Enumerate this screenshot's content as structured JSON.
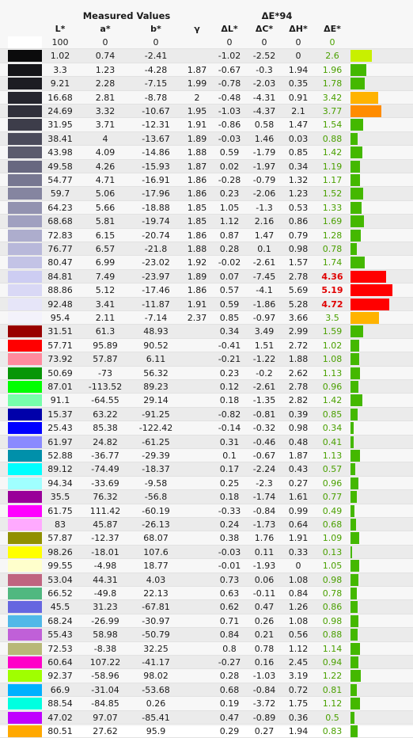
{
  "headers": {
    "measured": "Measured Values",
    "delta_e94": "ΔE*94"
  },
  "columns": [
    "L*",
    "a*",
    "b*",
    "γ",
    "ΔL*",
    "ΔC*",
    "ΔH*",
    "ΔE*"
  ],
  "colors": {
    "good": "#44b800",
    "warn": "#ffb300",
    "bad": "#ff0000",
    "lime": "#c8f000",
    "orange": "#ff8c00"
  },
  "rows": [
    {
      "sw": "#ffffff",
      "L": "100",
      "a": "0",
      "b": "0",
      "g": "",
      "dL": "0",
      "dC": "0",
      "dH": "0",
      "dE": "0",
      "lvl": "good",
      "v": 0
    },
    {
      "sw": "#0b0b0c",
      "L": "1.02",
      "a": "0.74",
      "b": "-2.41",
      "g": "",
      "dL": "-1.02",
      "dC": "-2.52",
      "dH": "0",
      "dE": "2.6",
      "lvl": "lime",
      "v": 2.6
    },
    {
      "sw": "#141418",
      "L": "3.3",
      "a": "1.23",
      "b": "-4.28",
      "g": "1.87",
      "dL": "-0.67",
      "dC": "-0.3",
      "dH": "1.94",
      "dE": "1.96",
      "lvl": "good",
      "v": 1.96
    },
    {
      "sw": "#1c1c22",
      "L": "9.21",
      "a": "2.28",
      "b": "-7.15",
      "g": "1.99",
      "dL": "-0.78",
      "dC": "-2.03",
      "dH": "0.35",
      "dE": "1.78",
      "lvl": "good",
      "v": 1.78
    },
    {
      "sw": "#25252e",
      "L": "16.68",
      "a": "2.81",
      "b": "-8.78",
      "g": "2",
      "dL": "-0.48",
      "dC": "-4.31",
      "dH": "0.91",
      "dE": "3.42",
      "lvl": "warn",
      "v": 3.42
    },
    {
      "sw": "#30303b",
      "L": "24.69",
      "a": "3.32",
      "b": "-10.67",
      "g": "1.95",
      "dL": "-1.03",
      "dC": "-4.37",
      "dH": "2.1",
      "dE": "3.77",
      "lvl": "orange",
      "v": 3.77
    },
    {
      "sw": "#3d3d4a",
      "L": "31.95",
      "a": "3.71",
      "b": "-12.31",
      "g": "1.91",
      "dL": "-0.86",
      "dC": "0.58",
      "dH": "1.47",
      "dE": "1.54",
      "lvl": "good",
      "v": 1.54
    },
    {
      "sw": "#4b4b5b",
      "L": "38.41",
      "a": "4",
      "b": "-13.67",
      "g": "1.89",
      "dL": "-0.03",
      "dC": "1.46",
      "dH": "0.03",
      "dE": "0.88",
      "lvl": "good",
      "v": 0.88
    },
    {
      "sw": "#5b5b6d",
      "L": "43.98",
      "a": "4.09",
      "b": "-14.86",
      "g": "1.88",
      "dL": "0.59",
      "dC": "-1.79",
      "dH": "0.85",
      "dE": "1.42",
      "lvl": "good",
      "v": 1.42
    },
    {
      "sw": "#686880",
      "L": "49.58",
      "a": "4.26",
      "b": "-15.93",
      "g": "1.87",
      "dL": "0.02",
      "dC": "-1.97",
      "dH": "0.34",
      "dE": "1.19",
      "lvl": "good",
      "v": 1.19
    },
    {
      "sw": "#777791",
      "L": "54.77",
      "a": "4.71",
      "b": "-16.91",
      "g": "1.86",
      "dL": "-0.28",
      "dC": "-0.79",
      "dH": "1.32",
      "dE": "1.17",
      "lvl": "good",
      "v": 1.17
    },
    {
      "sw": "#8585a0",
      "L": "59.7",
      "a": "5.06",
      "b": "-17.96",
      "g": "1.86",
      "dL": "0.23",
      "dC": "-2.06",
      "dH": "1.23",
      "dE": "1.52",
      "lvl": "good",
      "v": 1.52
    },
    {
      "sw": "#9292b0",
      "L": "64.23",
      "a": "5.66",
      "b": "-18.88",
      "g": "1.85",
      "dL": "1.05",
      "dC": "-1.3",
      "dH": "0.53",
      "dE": "1.33",
      "lvl": "good",
      "v": 1.33
    },
    {
      "sw": "#a0a0c0",
      "L": "68.68",
      "a": "5.81",
      "b": "-19.74",
      "g": "1.85",
      "dL": "1.12",
      "dC": "2.16",
      "dH": "0.86",
      "dE": "1.69",
      "lvl": "good",
      "v": 1.69
    },
    {
      "sw": "#adadcd",
      "L": "72.83",
      "a": "6.15",
      "b": "-20.74",
      "g": "1.86",
      "dL": "0.87",
      "dC": "1.47",
      "dH": "0.79",
      "dE": "1.28",
      "lvl": "good",
      "v": 1.28
    },
    {
      "sw": "#b8b8da",
      "L": "76.77",
      "a": "6.57",
      "b": "-21.8",
      "g": "1.88",
      "dL": "0.28",
      "dC": "0.1",
      "dH": "0.98",
      "dE": "0.78",
      "lvl": "good",
      "v": 0.78
    },
    {
      "sw": "#c3c3e6",
      "L": "80.47",
      "a": "6.99",
      "b": "-23.02",
      "g": "1.92",
      "dL": "-0.02",
      "dC": "-2.61",
      "dH": "1.57",
      "dE": "1.74",
      "lvl": "good",
      "v": 1.74
    },
    {
      "sw": "#cdcdf2",
      "L": "84.81",
      "a": "7.49",
      "b": "-23.97",
      "g": "1.89",
      "dL": "0.07",
      "dC": "-7.45",
      "dH": "2.78",
      "dE": "4.36",
      "lvl": "bad",
      "v": 4.36
    },
    {
      "sw": "#d9d8f5",
      "L": "88.86",
      "a": "5.12",
      "b": "-17.46",
      "g": "1.86",
      "dL": "0.57",
      "dC": "-4.1",
      "dH": "5.69",
      "dE": "5.19",
      "lvl": "bad",
      "v": 5.19
    },
    {
      "sw": "#e6e5f8",
      "L": "92.48",
      "a": "3.41",
      "b": "-11.87",
      "g": "1.91",
      "dL": "0.59",
      "dC": "-1.86",
      "dH": "5.28",
      "dE": "4.72",
      "lvl": "bad",
      "v": 4.72
    },
    {
      "sw": "#f3f2fb",
      "L": "95.4",
      "a": "2.11",
      "b": "-7.14",
      "g": "2.37",
      "dL": "0.85",
      "dC": "-0.97",
      "dH": "3.66",
      "dE": "3.5",
      "lvl": "warn",
      "v": 3.5
    },
    {
      "sw": "#990000",
      "L": "31.51",
      "a": "61.3",
      "b": "48.93",
      "g": "",
      "dL": "0.34",
      "dC": "3.49",
      "dH": "2.99",
      "dE": "1.59",
      "lvl": "good",
      "v": 1.59
    },
    {
      "sw": "#ff0000",
      "L": "57.71",
      "a": "95.89",
      "b": "90.52",
      "g": "",
      "dL": "-0.41",
      "dC": "1.51",
      "dH": "2.72",
      "dE": "1.02",
      "lvl": "good",
      "v": 1.02
    },
    {
      "sw": "#ff8b9e",
      "L": "73.92",
      "a": "57.87",
      "b": "6.11",
      "g": "",
      "dL": "-0.21",
      "dC": "-1.22",
      "dH": "1.88",
      "dE": "1.08",
      "lvl": "good",
      "v": 1.08
    },
    {
      "sw": "#079607",
      "L": "50.69",
      "a": "-73",
      "b": "56.32",
      "g": "",
      "dL": "0.23",
      "dC": "-0.2",
      "dH": "2.62",
      "dE": "1.13",
      "lvl": "good",
      "v": 1.13
    },
    {
      "sw": "#00ff00",
      "L": "87.01",
      "a": "-113.52",
      "b": "89.23",
      "g": "",
      "dL": "0.12",
      "dC": "-2.61",
      "dH": "2.78",
      "dE": "0.96",
      "lvl": "good",
      "v": 0.96
    },
    {
      "sw": "#77ffaa",
      "L": "91.1",
      "a": "-64.55",
      "b": "29.14",
      "g": "",
      "dL": "0.18",
      "dC": "-1.35",
      "dH": "2.82",
      "dE": "1.42",
      "lvl": "good",
      "v": 1.42
    },
    {
      "sw": "#0000aa",
      "L": "15.37",
      "a": "63.22",
      "b": "-91.25",
      "g": "",
      "dL": "-0.82",
      "dC": "-0.81",
      "dH": "0.39",
      "dE": "0.85",
      "lvl": "good",
      "v": 0.85
    },
    {
      "sw": "#0000ff",
      "L": "25.43",
      "a": "85.38",
      "b": "-122.42",
      "g": "",
      "dL": "-0.14",
      "dC": "-0.32",
      "dH": "0.98",
      "dE": "0.34",
      "lvl": "good",
      "v": 0.34
    },
    {
      "sw": "#8a8aff",
      "L": "61.97",
      "a": "24.82",
      "b": "-61.25",
      "g": "",
      "dL": "0.31",
      "dC": "-0.46",
      "dH": "0.48",
      "dE": "0.41",
      "lvl": "good",
      "v": 0.41
    },
    {
      "sw": "#0090aa",
      "L": "52.88",
      "a": "-36.77",
      "b": "-29.39",
      "g": "",
      "dL": "0.1",
      "dC": "-0.67",
      "dH": "1.87",
      "dE": "1.13",
      "lvl": "good",
      "v": 1.13
    },
    {
      "sw": "#00ffff",
      "L": "89.12",
      "a": "-74.49",
      "b": "-18.37",
      "g": "",
      "dL": "0.17",
      "dC": "-2.24",
      "dH": "0.43",
      "dE": "0.57",
      "lvl": "good",
      "v": 0.57
    },
    {
      "sw": "#a0ffff",
      "L": "94.34",
      "a": "-33.69",
      "b": "-9.58",
      "g": "",
      "dL": "0.25",
      "dC": "-2.3",
      "dH": "0.27",
      "dE": "0.96",
      "lvl": "good",
      "v": 0.96
    },
    {
      "sw": "#990099",
      "L": "35.5",
      "a": "76.32",
      "b": "-56.8",
      "g": "",
      "dL": "0.18",
      "dC": "-1.74",
      "dH": "1.61",
      "dE": "0.77",
      "lvl": "good",
      "v": 0.77
    },
    {
      "sw": "#ff00ff",
      "L": "61.75",
      "a": "111.42",
      "b": "-60.19",
      "g": "",
      "dL": "-0.33",
      "dC": "-0.84",
      "dH": "0.99",
      "dE": "0.49",
      "lvl": "good",
      "v": 0.49
    },
    {
      "sw": "#ffaaff",
      "L": "83",
      "a": "45.87",
      "b": "-26.13",
      "g": "",
      "dL": "0.24",
      "dC": "-1.73",
      "dH": "0.64",
      "dE": "0.68",
      "lvl": "good",
      "v": 0.68
    },
    {
      "sw": "#909000",
      "L": "57.87",
      "a": "-12.37",
      "b": "68.07",
      "g": "",
      "dL": "0.38",
      "dC": "1.76",
      "dH": "1.91",
      "dE": "1.09",
      "lvl": "good",
      "v": 1.09
    },
    {
      "sw": "#ffff00",
      "L": "98.26",
      "a": "-18.01",
      "b": "107.6",
      "g": "",
      "dL": "-0.03",
      "dC": "0.11",
      "dH": "0.33",
      "dE": "0.13",
      "lvl": "good",
      "v": 0.13
    },
    {
      "sw": "#ffffcc",
      "L": "99.55",
      "a": "-4.98",
      "b": "18.77",
      "g": "",
      "dL": "-0.01",
      "dC": "-1.93",
      "dH": "0",
      "dE": "1.05",
      "lvl": "good",
      "v": 1.05
    },
    {
      "sw": "#c06480",
      "L": "53.04",
      "a": "44.31",
      "b": "4.03",
      "g": "",
      "dL": "0.73",
      "dC": "0.06",
      "dH": "1.08",
      "dE": "0.98",
      "lvl": "good",
      "v": 0.98
    },
    {
      "sw": "#50b880",
      "L": "66.52",
      "a": "-49.8",
      "b": "22.13",
      "g": "",
      "dL": "0.63",
      "dC": "-0.11",
      "dH": "0.84",
      "dE": "0.78",
      "lvl": "good",
      "v": 0.78
    },
    {
      "sw": "#6666e0",
      "L": "45.5",
      "a": "31.23",
      "b": "-67.81",
      "g": "",
      "dL": "0.62",
      "dC": "0.47",
      "dH": "1.26",
      "dE": "0.86",
      "lvl": "good",
      "v": 0.86
    },
    {
      "sw": "#50b8e8",
      "L": "68.24",
      "a": "-26.99",
      "b": "-30.97",
      "g": "",
      "dL": "0.71",
      "dC": "0.26",
      "dH": "1.08",
      "dE": "0.98",
      "lvl": "good",
      "v": 0.98
    },
    {
      "sw": "#c060d8",
      "L": "55.43",
      "a": "58.98",
      "b": "-50.79",
      "g": "",
      "dL": "0.84",
      "dC": "0.21",
      "dH": "0.56",
      "dE": "0.88",
      "lvl": "good",
      "v": 0.88
    },
    {
      "sw": "#b8b878",
      "L": "72.53",
      "a": "-8.38",
      "b": "32.25",
      "g": "",
      "dL": "0.8",
      "dC": "0.78",
      "dH": "1.12",
      "dE": "1.14",
      "lvl": "good",
      "v": 1.14
    },
    {
      "sw": "#ff00c8",
      "L": "60.64",
      "a": "107.22",
      "b": "-41.17",
      "g": "",
      "dL": "-0.27",
      "dC": "0.16",
      "dH": "2.45",
      "dE": "0.94",
      "lvl": "good",
      "v": 0.94
    },
    {
      "sw": "#a0ff00",
      "L": "92.37",
      "a": "-58.96",
      "b": "98.02",
      "g": "",
      "dL": "0.28",
      "dC": "-1.03",
      "dH": "3.19",
      "dE": "1.22",
      "lvl": "good",
      "v": 1.22
    },
    {
      "sw": "#00b0ff",
      "L": "66.9",
      "a": "-31.04",
      "b": "-53.68",
      "g": "",
      "dL": "0.68",
      "dC": "-0.84",
      "dH": "0.72",
      "dE": "0.81",
      "lvl": "good",
      "v": 0.81
    },
    {
      "sw": "#00ffe0",
      "L": "88.54",
      "a": "-84.85",
      "b": "0.26",
      "g": "",
      "dL": "0.19",
      "dC": "-3.72",
      "dH": "1.75",
      "dE": "1.12",
      "lvl": "good",
      "v": 1.12
    },
    {
      "sw": "#c000ff",
      "L": "47.02",
      "a": "97.07",
      "b": "-85.41",
      "g": "",
      "dL": "0.47",
      "dC": "-0.89",
      "dH": "0.36",
      "dE": "0.5",
      "lvl": "good",
      "v": 0.5
    },
    {
      "sw": "#ffa800",
      "L": "80.51",
      "a": "27.62",
      "b": "95.9",
      "g": "",
      "dL": "0.29",
      "dC": "0.27",
      "dH": "1.94",
      "dE": "0.83",
      "lvl": "good",
      "v": 0.83
    }
  ]
}
